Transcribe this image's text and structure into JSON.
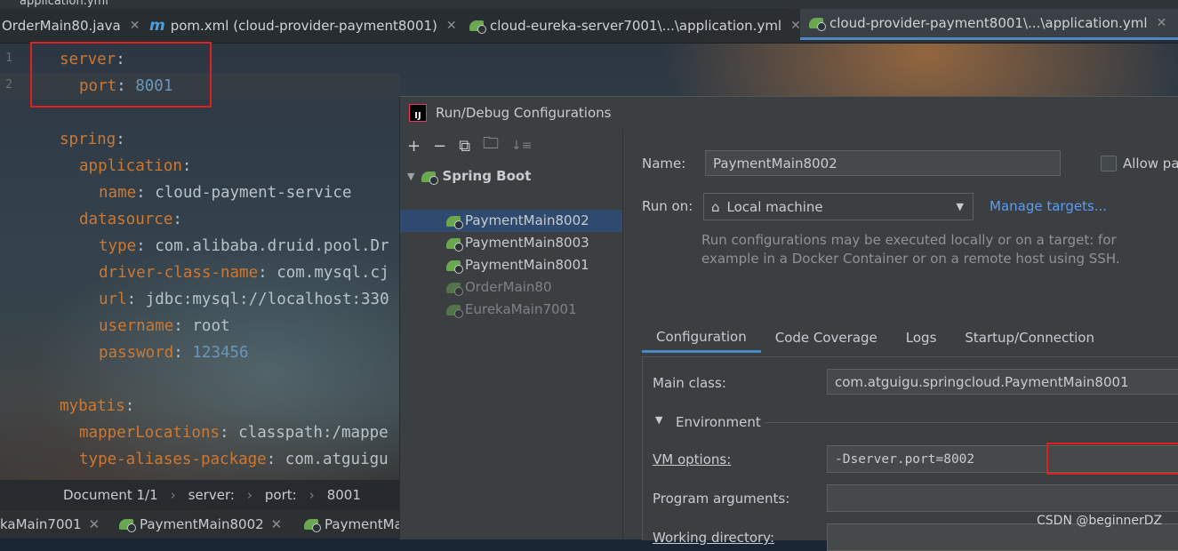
{
  "window": {
    "file_title": "application.yml"
  },
  "editor_tabs": [
    {
      "label": "OrderMain80.java",
      "icon": "java-class-icon"
    },
    {
      "label": "pom.xml (cloud-provider-payment8001)",
      "icon": "maven-icon"
    },
    {
      "label": "cloud-eureka-server7001\\...\\application.yml",
      "icon": "spring-boot-icon"
    },
    {
      "label": "cloud-provider-payment8001\\...\\application.yml",
      "icon": "spring-boot-icon",
      "active": true
    }
  ],
  "code": {
    "line_numbers": [
      "1",
      "2"
    ],
    "lines": [
      {
        "key": "server",
        "sep": ":",
        "value": ""
      },
      {
        "key": "port",
        "sep": ": ",
        "value": "8001"
      },
      {
        "key": "",
        "sep": "",
        "value": ""
      },
      {
        "key": "spring",
        "sep": ":",
        "value": ""
      },
      {
        "key": "application",
        "sep": ":",
        "value": ""
      },
      {
        "key": "name",
        "sep": ": ",
        "value": "cloud-payment-service"
      },
      {
        "key": "datasource",
        "sep": ":",
        "value": ""
      },
      {
        "key": "type",
        "sep": ": ",
        "value": "com.alibaba.druid.pool.Dr"
      },
      {
        "key": "driver-class-name",
        "sep": ": ",
        "value": "com.mysql.cj"
      },
      {
        "key": "url",
        "sep": ": ",
        "value": "jdbc:mysql://localhost:330"
      },
      {
        "key": "username",
        "sep": ": ",
        "value": "root"
      },
      {
        "key": "password",
        "sep": ": ",
        "value": "123456"
      },
      {
        "key": "",
        "sep": "",
        "value": ""
      },
      {
        "key": "mybatis",
        "sep": ":",
        "value": ""
      },
      {
        "key": "mapperLocations",
        "sep": ": ",
        "value": "classpath:/mappe"
      },
      {
        "key": "type-aliases-package",
        "sep": ": ",
        "value": "com.atguigu"
      }
    ]
  },
  "breadcrumb": {
    "doc": "Document 1/1",
    "seg1": "server:",
    "seg2": "port:",
    "seg3": "8001"
  },
  "bottom_tabs": [
    "kaMain7001",
    "PaymentMain8002",
    "PaymentMa"
  ],
  "dialog": {
    "title": "Run/Debug Configurations",
    "tree": {
      "group": "Spring Boot",
      "items": [
        {
          "label": "PaymentMain8002",
          "selected": true
        },
        {
          "label": "PaymentMain8003"
        },
        {
          "label": "PaymentMain8001"
        },
        {
          "label": "OrderMain80",
          "dim": true
        },
        {
          "label": "EurekaMain7001",
          "dim": true
        }
      ]
    },
    "name_label": "Name:",
    "name_value": "PaymentMain8002",
    "allow_label": "Allow pa",
    "run_on_label": "Run on:",
    "run_on_value": "Local machine",
    "manage_targets": "Manage targets...",
    "hint_line1": "Run configurations may be executed locally or on a target: for",
    "hint_line2": "example in a Docker Container or on a remote host using SSH.",
    "tabs": [
      "Configuration",
      "Code Coverage",
      "Logs",
      "Startup/Connection"
    ],
    "main_class_label": "Main class:",
    "main_class_value": "com.atguigu.springcloud.PaymentMain8001",
    "environment_label": "Environment",
    "vm_options_label": "VM options:",
    "vm_options_value": "-Dserver.port=8002",
    "program_args_label": "Program arguments:",
    "working_dir_label": "Working directory:"
  },
  "watermark": "CSDN @beginnerDZ",
  "colors": {
    "accent": "#4a88c7",
    "highlight_box": "#e02020",
    "yaml_key": "#cc7832",
    "number": "#6897bb"
  }
}
